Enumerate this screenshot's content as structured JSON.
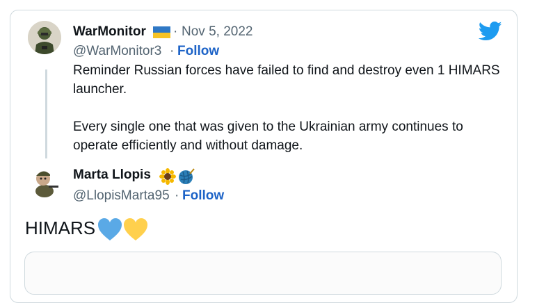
{
  "quoted_tweet": {
    "author_name": "WarMonitor",
    "author_flag_icon": "ukraine-flag-icon",
    "separator": "·",
    "date": "Nov 5, 2022",
    "handle": "@WarMonitor3",
    "follow_label": "Follow",
    "text_paragraphs": [
      "Reminder Russian forces have failed to find and destroy even 1 HIMARS launcher.",
      "Every single one that was given to the Ukrainian army continues to operate efficiently and without damage."
    ]
  },
  "reply_tweet": {
    "author_name": "Marta Llopis",
    "author_emojis": [
      "sunflower-icon",
      "yarn-ball-icon"
    ],
    "separator": "·",
    "handle": "@LlopisMarta95",
    "follow_label": "Follow",
    "text": "HIMARS",
    "text_emojis": [
      "blue-heart-icon",
      "yellow-heart-icon"
    ]
  },
  "colors": {
    "link_blue": "#1d63c7",
    "twitter_blue": "#1d9bf0",
    "secondary_text": "#536471",
    "border": "#cfd9de",
    "flag_blue": "#2f78c5",
    "flag_yellow": "#f7c325",
    "heart_blue": "#5aa9e6",
    "heart_yellow": "#ffd04d"
  }
}
